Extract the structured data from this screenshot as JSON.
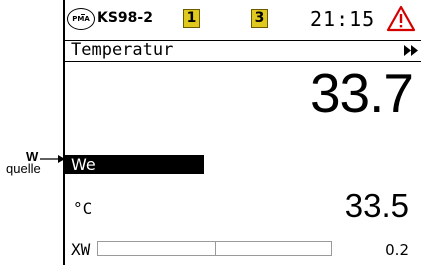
{
  "annotation": {
    "w_label": "W",
    "source_label": "quelle"
  },
  "status_bar": {
    "logo_text": "PMA",
    "device_name": "KS98-2",
    "indicators": [
      "1",
      "3"
    ],
    "indicator_color": "#e0c91e",
    "time": "21:15",
    "alarm_icon": "warning-triangle-icon",
    "alarm_color": "#d40000"
  },
  "title_bar": {
    "title": "Temperatur",
    "next_icon": "fast-forward-icon"
  },
  "process_value": "33.7",
  "setpoint_source": "We",
  "unit": "°C",
  "setpoint_value": "33.5",
  "deviation": {
    "label": "XW",
    "value": "0.2",
    "fraction": 0.0
  }
}
